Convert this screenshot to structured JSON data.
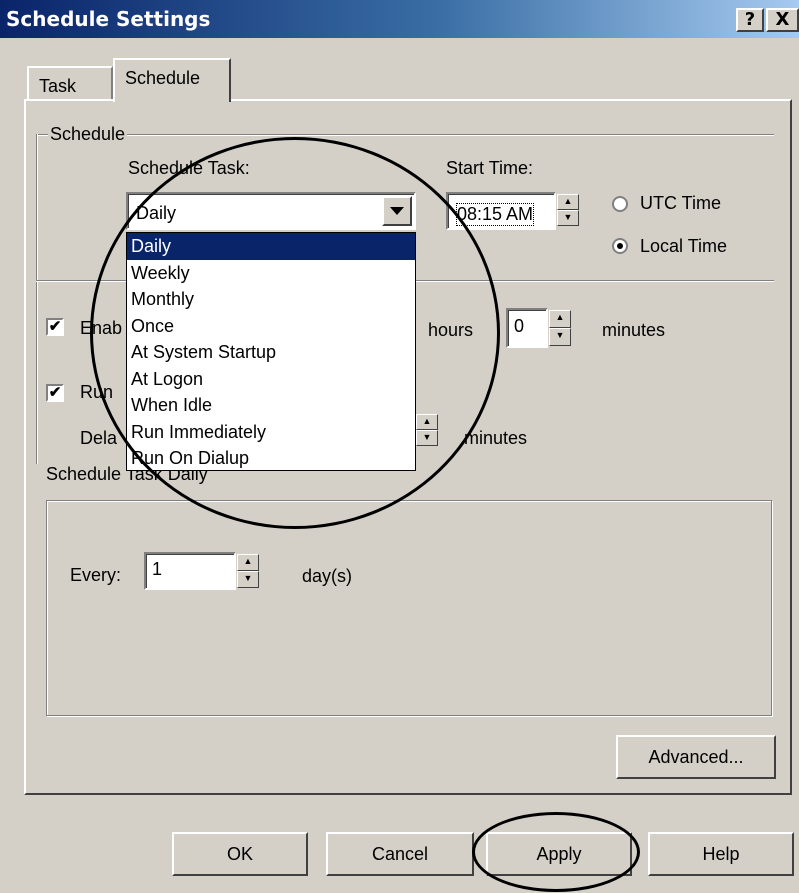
{
  "window": {
    "title": "Schedule Settings",
    "help_btn": "?",
    "close_btn": "X"
  },
  "tabs": [
    {
      "label": "Task"
    },
    {
      "label": "Schedule"
    }
  ],
  "schedule_group": {
    "label": "Schedule",
    "schedule_task_label": "Schedule Task:",
    "schedule_task_value": "Daily",
    "start_time_label": "Start Time:",
    "start_time_value": "08:15 AM",
    "utc_label": "UTC Time",
    "local_label": "Local Time",
    "selected_time_mode": "Local Time"
  },
  "dropdown_options": [
    "Daily",
    "Weekly",
    "Monthly",
    "Once",
    "At System Startup",
    "At Logon",
    "When Idle",
    "Run Immediately",
    "Run On Dialup"
  ],
  "options": {
    "enable_label_visible": "Enab",
    "hours_label": "hours",
    "minutes_value": "0",
    "minutes_label": "minutes",
    "run_label_visible": "Run",
    "delay_label_visible": "Dela",
    "delay_minutes_label": "minutes",
    "check_mark": "✔"
  },
  "daily_group": {
    "label": "Schedule Task Daily",
    "every_label": "Every:",
    "every_value": "1",
    "days_label": "day(s)"
  },
  "buttons": {
    "advanced": "Advanced...",
    "ok": "OK",
    "cancel": "Cancel",
    "apply": "Apply",
    "help": "Help"
  },
  "icons": {
    "dropdown_arrow": "chevron-down-icon",
    "spin_up": "▲",
    "spin_down": "▼"
  }
}
